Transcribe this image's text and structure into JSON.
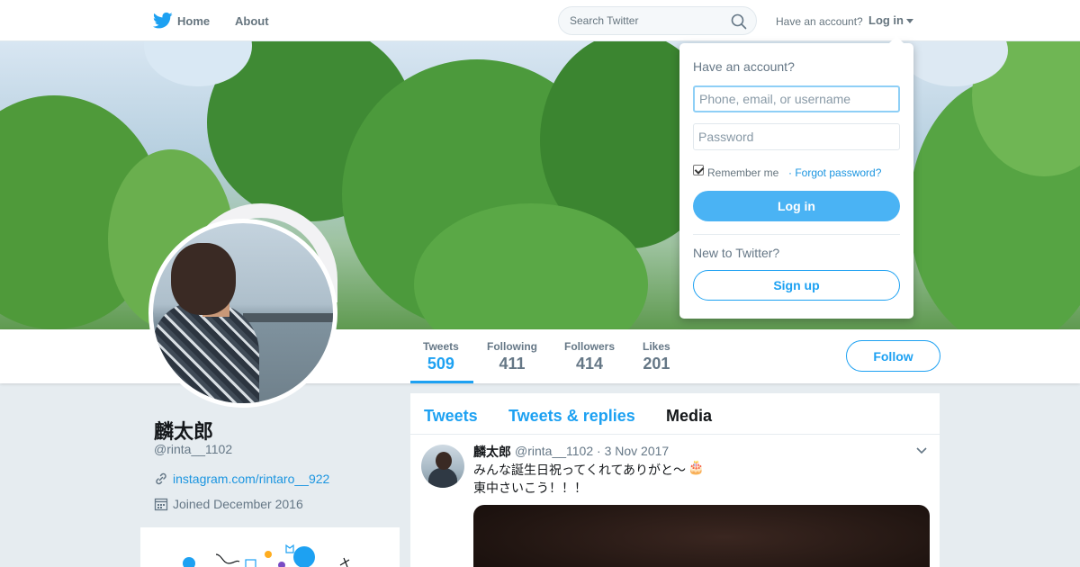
{
  "nav": {
    "home": "Home",
    "about": "About",
    "search_placeholder": "Search Twitter",
    "have_account": "Have an account?",
    "login": "Log in"
  },
  "profile": {
    "name": "麟太郎",
    "handle": "@rinta__1102",
    "link": "instagram.com/rintaro__922",
    "joined": "Joined December 2016",
    "follow_label": "Follow"
  },
  "stats": [
    {
      "label": "Tweets",
      "value": "509"
    },
    {
      "label": "Following",
      "value": "411"
    },
    {
      "label": "Followers",
      "value": "414"
    },
    {
      "label": "Likes",
      "value": "201"
    }
  ],
  "tabs": [
    "Tweets",
    "Tweets & replies",
    "Media"
  ],
  "tweet": {
    "name": "麟太郎",
    "meta": "@rinta__1102 · 3 Nov 2017",
    "line1": "みんな誕生日祝ってくれてありがと〜",
    "emoji": "🎂",
    "line2": "東中さいこう！！！"
  },
  "login_dropdown": {
    "title": "Have an account?",
    "user_placeholder": "Phone, email, or username",
    "pass_placeholder": "Password",
    "remember": "Remember me",
    "forgot": "· Forgot password?",
    "login_button": "Log in",
    "new_to": "New to Twitter?",
    "signup_button": "Sign up"
  },
  "colors": {
    "accent": "#1da1f2",
    "background": "#e6ecf0"
  }
}
